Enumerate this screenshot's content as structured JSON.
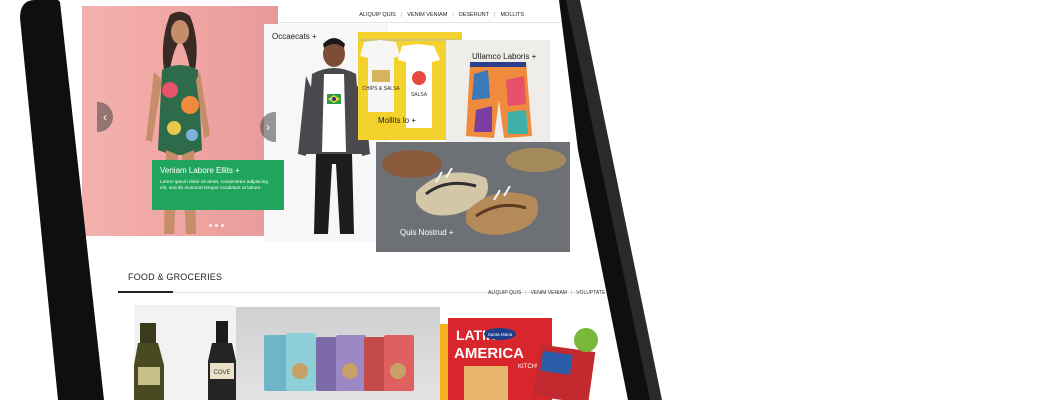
{
  "top_nav": {
    "items": [
      "ALIQUIP QUIS",
      "VENIM VENIAM",
      "DESERUNT",
      "MOLLITS"
    ]
  },
  "hero": {
    "prev_arrow": "‹",
    "next_arrow": "›",
    "promo_title": "Veniam Labore Ellits +",
    "promo_text": "Lorem ipsum dolor sit amet, consectetur adipiscing elit, sed do eiusmod tempor incididunt ut labore.",
    "slide_count": 3
  },
  "panels": {
    "boy": "Occaecats +",
    "tees": "Mollits lo +",
    "shorts": "Ullamco Laboris +",
    "shoes": "Quis Nostrud +"
  },
  "section": {
    "title": "FOOD & GROCERIES",
    "subnav": [
      "ALIQUIP QUIS",
      "VENIM VENIAM",
      "VOLUPTATE"
    ]
  },
  "products": {
    "latin_brand_1": "LATIN",
    "latin_brand_2": "AMERICA",
    "latin_brand_3": "KITCHE",
    "santa_maria": "Santa Maria",
    "tee_print_1": "CHIPS & SALSA",
    "tee_print_2": "SALSA",
    "bottle_label": "COVE"
  },
  "colors": {
    "accent_green": "#1fa65c",
    "bezel": "#0f0f10"
  }
}
